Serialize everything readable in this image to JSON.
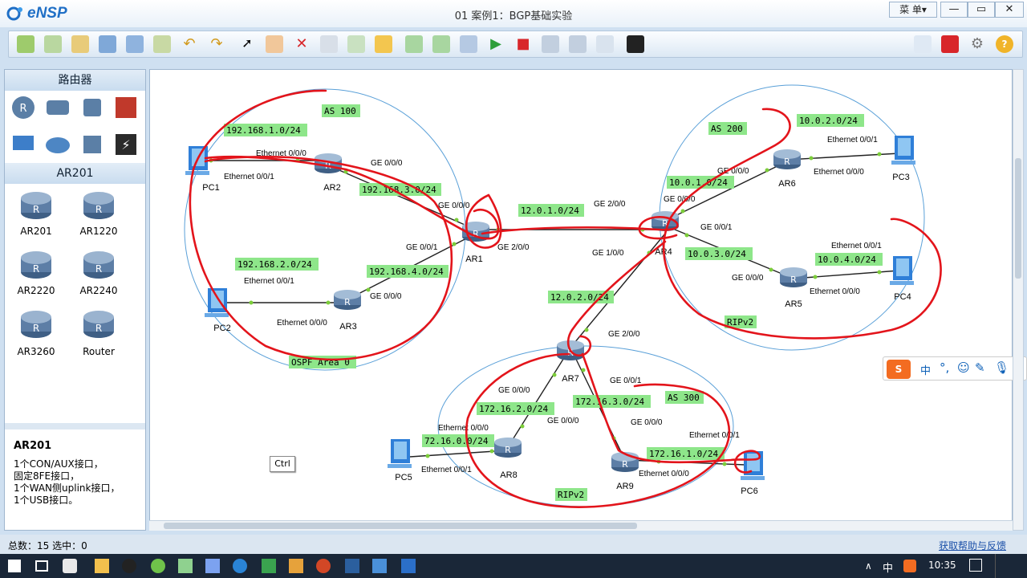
{
  "app": {
    "name": "eNSP",
    "title": "01 案例1：BGP基础实验",
    "menu_label": "菜 单▾",
    "min": "—",
    "restore": "▭",
    "close": "✕"
  },
  "sidebar": {
    "category_title": "路由器",
    "model_title": "AR201",
    "devices": [
      {
        "label": "AR201"
      },
      {
        "label": "AR1220"
      },
      {
        "label": "AR2220"
      },
      {
        "label": "AR2240"
      },
      {
        "label": "AR3260"
      },
      {
        "label": "Router"
      }
    ],
    "info": {
      "title": "AR201",
      "lines": [
        "1个CON/AUX接口，",
        "固定8FE接口，",
        "1个WAN侧uplink接口，",
        "1个USB接口。"
      ]
    }
  },
  "canvas": {
    "nodes": {
      "PC1": "PC1",
      "PC2": "PC2",
      "PC3": "PC3",
      "PC4": "PC4",
      "PC5": "PC5",
      "PC6": "PC6",
      "AR1": "AR1",
      "AR2": "AR2",
      "AR3": "AR3",
      "AR4": "AR4",
      "AR5": "AR5",
      "AR6": "AR6",
      "AR7": "AR7",
      "AR8": "AR8",
      "AR9": "AR9"
    },
    "nets": {
      "n1": "AS 100",
      "n2": "192.168.1.0/24",
      "n3": "192.168.3.0/24",
      "n4": "192.168.2.0/24",
      "n5": "192.168.4.0/24",
      "n6": "OSPF Area 0",
      "n7": "12.0.1.0/24",
      "n8": "AS 200",
      "n9": "10.0.2.0/24",
      "n10": "10.0.1.0/24",
      "n11": "10.0.3.0/24",
      "n12": "10.0.4.0/24",
      "n13": "RIPv2",
      "n14": "12.0.2.0/24",
      "n15": "AS 300",
      "n16": "172.16.2.0/24",
      "n17": "172.16.3.0/24",
      "n18": "72.16.0.0/24",
      "n19": "172.16.1.0/24",
      "n20": "RIPv2"
    },
    "ifs": {
      "i1": "Ethernet 0/0/0",
      "i2": "Ethernet 0/0/1",
      "i3": "GE 0/0/0",
      "i4": "GE 0/0/0",
      "i5": "GE 0/0/1",
      "i6": "GE 2/0/0",
      "i7": "Ethernet 0/0/1",
      "i8": "GE 0/0/0",
      "i9": "Ethernet 0/0/0",
      "i10": "GE 2/0/0",
      "i11": "GE 0/0/0",
      "i12": "GE 1/0/0",
      "i13": "GE 0/0/1",
      "i14": "Ethernet 0/0/1",
      "i15": "Ethernet 0/0/0",
      "i16": "GE 0/0/0",
      "i17": "Ethernet 0/0/1",
      "i18": "GE 0/0/0",
      "i19": "Ethernet 0/0/0",
      "i20": "GE 2/0/0",
      "i21": "GE 0/0/0",
      "i22": "GE 0/0/1",
      "i23": "GE 0/0/0",
      "i24": "Ethernet 0/0/0",
      "i25": "Ethernet 0/0/1",
      "i26": "GE 0/0/0",
      "i27": "Ethernet 0/0/1",
      "i28": "Ethernet 0/0/0"
    },
    "ctrl": "Ctrl"
  },
  "status": {
    "left": "总数：15  选中：0",
    "right": "获取帮助与反馈"
  },
  "taskbar": {
    "time": "10:35",
    "ime": "中"
  },
  "colors": {
    "label_bg": "#8ee68a",
    "annotation": "#e3141b",
    "circle": "#5aa0d8",
    "link": "#222222"
  }
}
